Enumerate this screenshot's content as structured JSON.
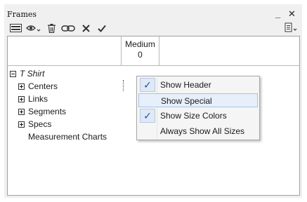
{
  "window": {
    "title": "Frames",
    "minimize_glyph": "_",
    "close_glyph": "✕"
  },
  "toolbar": {
    "icons": [
      "list-view-icon",
      "eye-dropdown-icon",
      "trash-icon",
      "link-icon",
      "delete-x-icon",
      "checkmark-icon"
    ],
    "right_icon": "clipboard-dropdown-icon"
  },
  "grid": {
    "columns": [
      {
        "label": "Medium",
        "value": "0"
      }
    ],
    "tree": [
      {
        "label": "T Shirt",
        "expander": "⊟",
        "italic": true
      },
      {
        "label": "Centers",
        "expander": "⊞"
      },
      {
        "label": "Links",
        "expander": "⊞"
      },
      {
        "label": "Segments",
        "expander": "⊞"
      },
      {
        "label": "Specs",
        "expander": "⊞"
      },
      {
        "label": "Measurement Charts",
        "expander": ""
      }
    ]
  },
  "context_menu": {
    "items": [
      {
        "label": "Show Header",
        "checked": true
      },
      {
        "label": "Show Special",
        "checked": false,
        "highlighted": true
      },
      {
        "label": "Show Size Colors",
        "checked": true
      },
      {
        "label": "Always Show All Sizes",
        "checked": false
      }
    ],
    "check_glyph": "✓"
  },
  "colors": {
    "accent": "#1c4fb7",
    "highlight": "#e6effa",
    "panel": "#f0f0f0"
  }
}
